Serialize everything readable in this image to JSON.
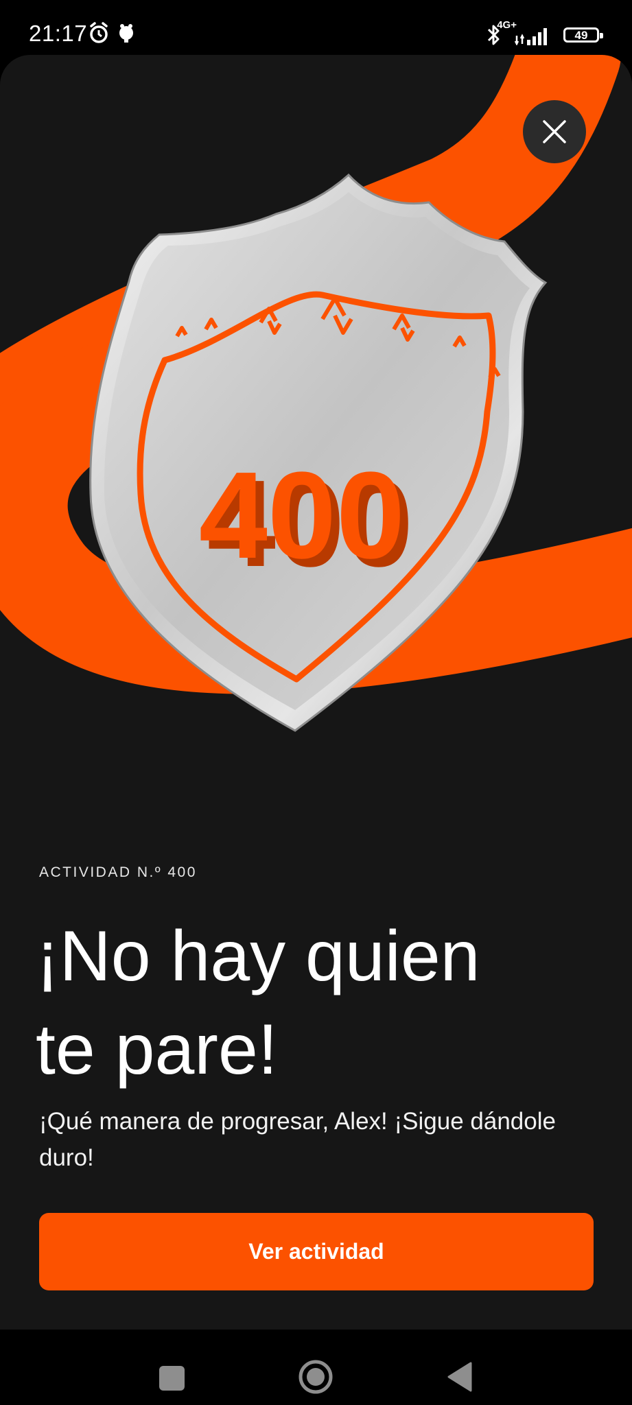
{
  "status_bar": {
    "time": "21:17",
    "network": "4G+",
    "battery": "49"
  },
  "badge": {
    "number": "400",
    "accent_color": "#fc5200"
  },
  "content": {
    "eyebrow": "ACTIVIDAD N.º 400",
    "headline_line1": "¡No hay quien",
    "headline_line2": "te pare!",
    "subtitle": "¡Qué manera de progresar, Alex! ¡Sigue dándole duro!",
    "cta_label": "Ver actividad"
  },
  "icons": {
    "close": "close-icon",
    "alarm": "alarm-icon",
    "notification": "notification-icon",
    "bluetooth": "bluetooth-icon",
    "signal": "signal-icon",
    "nav_recents": "recents-icon",
    "nav_home": "home-icon",
    "nav_back": "back-icon"
  }
}
